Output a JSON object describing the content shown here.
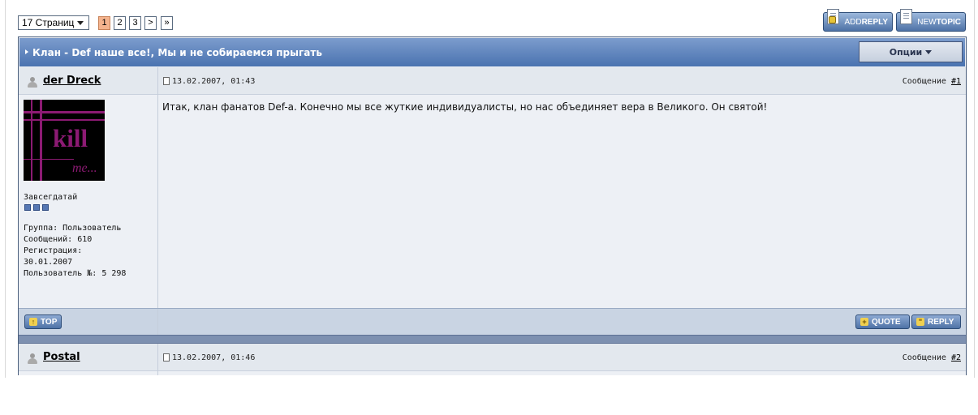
{
  "pagination": {
    "dropdown_label": "17 Страниц",
    "pages": [
      "1",
      "2",
      "3"
    ],
    "next": ">",
    "last": "»"
  },
  "toolbar": {
    "add_reply": {
      "part1": "ADD",
      "part2": "REPLY"
    },
    "new_topic": {
      "part1": "NEW",
      "part2": "TOPIC"
    }
  },
  "topic": {
    "title": "Клан - Def наше все!, Мы и не собираемся прыгать",
    "options_label": "Опции"
  },
  "posts": [
    {
      "username": "der Dreck",
      "date": "13.02.2007, 01:43",
      "post_label": "Сообщение",
      "post_num": "#1",
      "rank": "Завсегдатай",
      "rank_pips": 3,
      "group": "Группа: Пользователь",
      "messages": "Сообщений: 610",
      "registration_label": "Регистрация:",
      "registration_date": "30.01.2007",
      "user_no": "Пользователь №: 5 298",
      "body": "Итак, клан фанатов Def-а. Конечно мы все жуткие индивидуалисты, но нас объединяет вера в Великого. Он святой!",
      "avatar": {
        "main_text": "kill",
        "sub_text": "me...",
        "color": "#8c1a73"
      }
    },
    {
      "username": "Postal",
      "date": "13.02.2007, 01:46",
      "post_label": "Сообщение",
      "post_num": "#2"
    }
  ],
  "post_actions": {
    "top": "TOP",
    "quote": "QUOTE",
    "reply": "REPLY"
  },
  "colors": {
    "header_gradient_top": "#7c9ccd",
    "header_gradient_bottom": "#4a73b0",
    "row_bg": "#edf0f5",
    "current_page": "#f4b38d"
  },
  "icons": [
    "caret-down-icon",
    "doc-plus-icon",
    "doc-icon",
    "user-icon",
    "post-icon",
    "arrow-up-icon",
    "plus-icon",
    "quote-icon"
  ]
}
